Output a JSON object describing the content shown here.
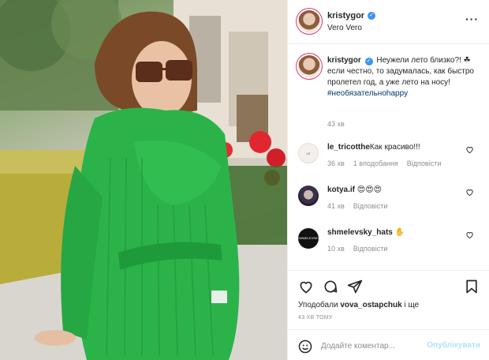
{
  "post": {
    "username": "kristygor",
    "location": "Vero Vero",
    "more_icon": "more-horizontal-icon"
  },
  "caption": {
    "username": "kristygor",
    "text": "Неужели лето близко?! ☘если честно, то задумалась, как быстро пролетел год, а уже лето на носу!",
    "hashtag": "#необязательноhappy",
    "time": "43 хв"
  },
  "comments": [
    {
      "username": "le_tricotthe",
      "text": "Как красиво!!!",
      "time": "36 хв",
      "likes": "1 вподобання",
      "reply": "Відповісти"
    },
    {
      "username": "kotya.if",
      "text": "😍😍😍",
      "time": "41 хв",
      "reply": "Відповісти"
    },
    {
      "username": "shmelevsky_hats",
      "text": "✋",
      "time": "10 хв",
      "reply": "Відповісти"
    }
  ],
  "actions": {
    "liked_prefix": "Уподобали",
    "liked_user": "vova_ostapchuk",
    "liked_suffix": "і ще",
    "ago": "43 ХВ ТОМУ"
  },
  "add_comment": {
    "placeholder": "Додайте коментар...",
    "publish_label": "Опублікувати"
  },
  "colors": {
    "accent": "#3897f0",
    "sweater": "#2bb34a",
    "muted": "#8e8e8e"
  }
}
